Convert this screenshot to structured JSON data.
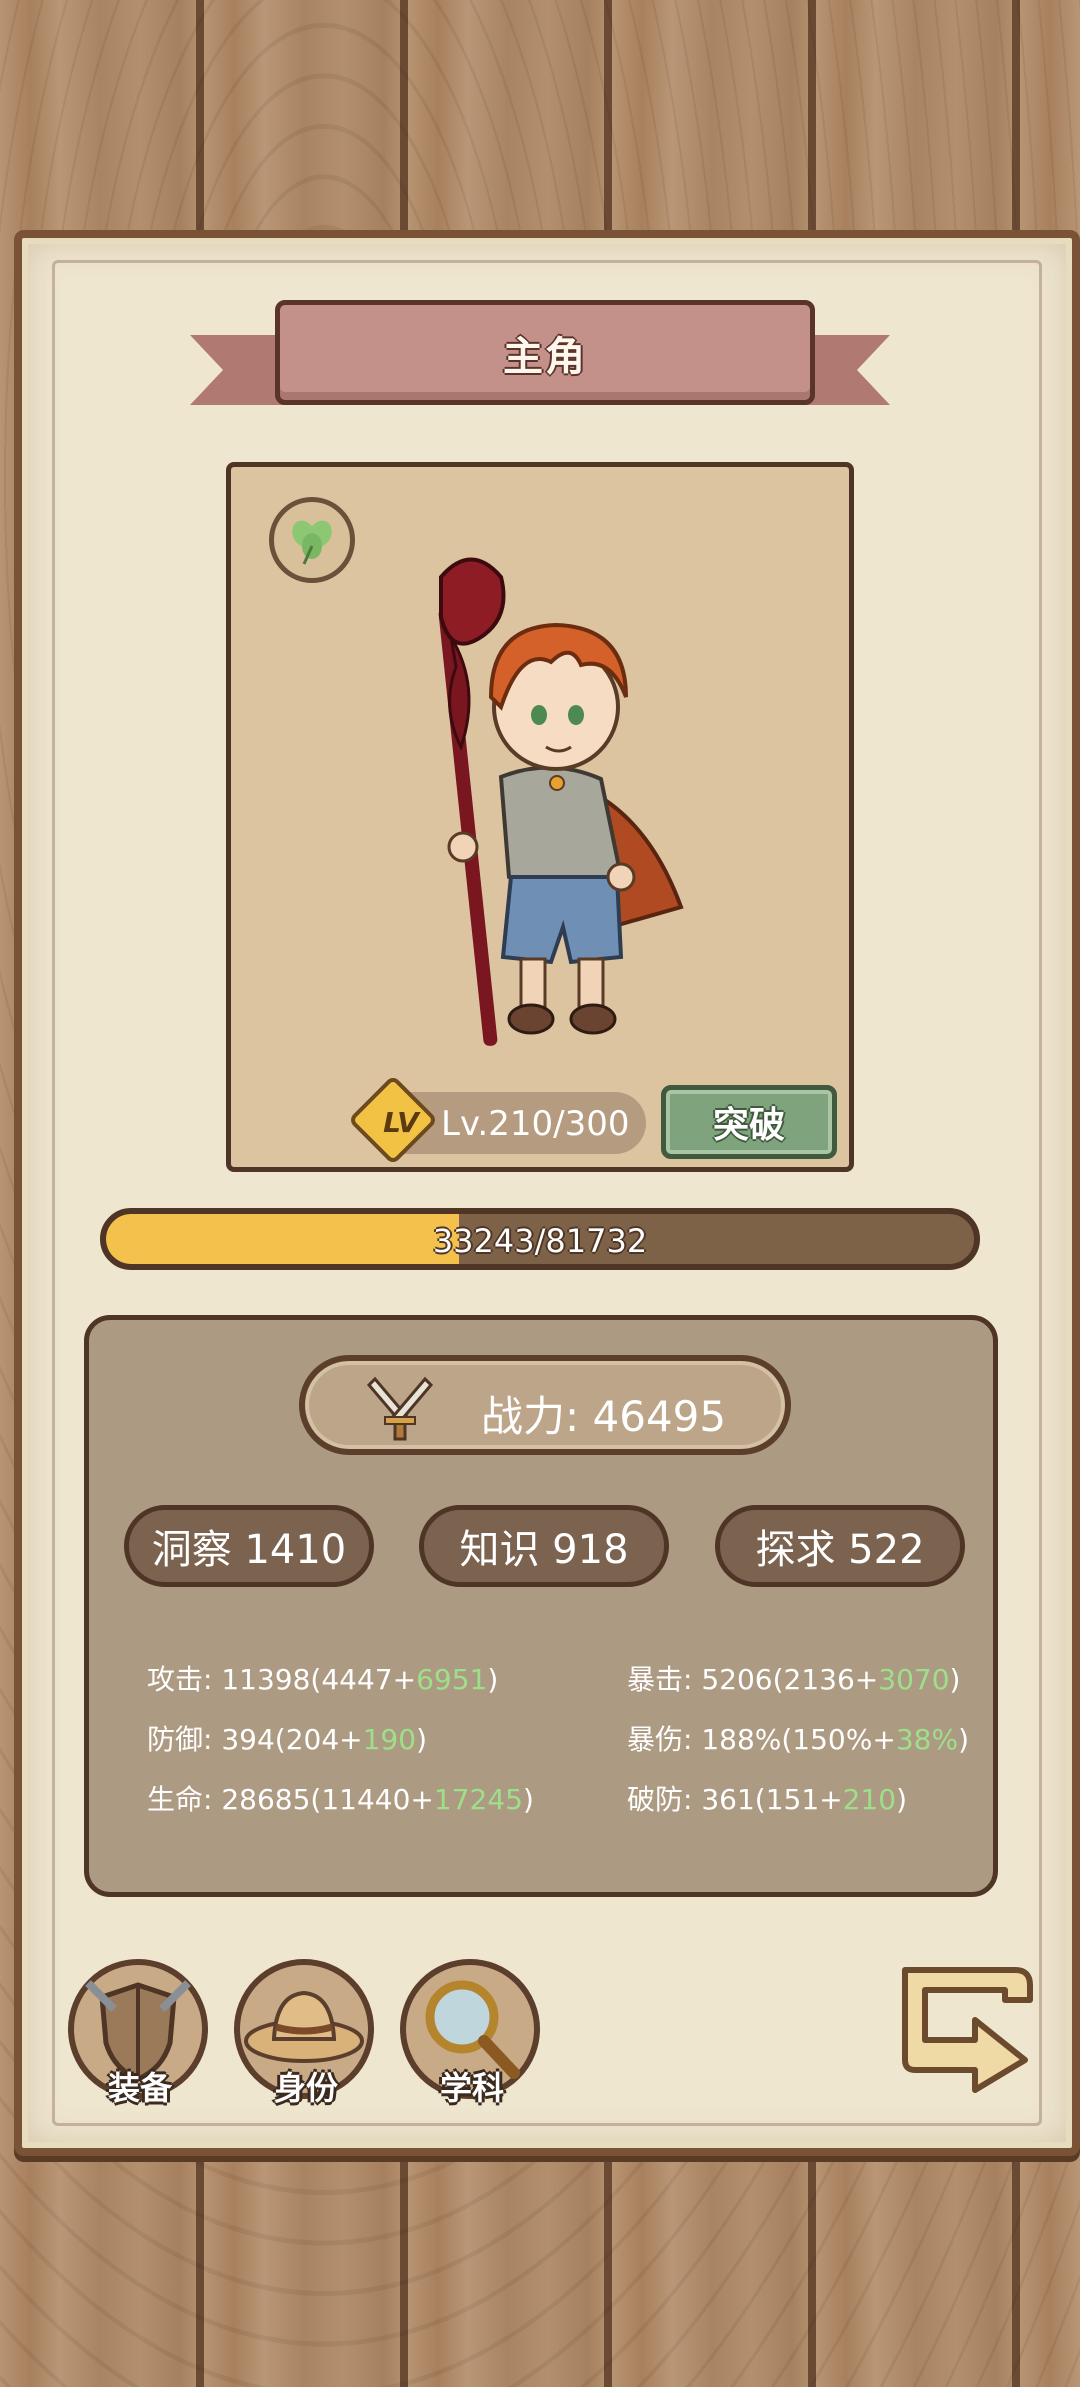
{
  "header": {
    "title": "主角"
  },
  "portrait": {
    "level_badge": "LV",
    "level_text": "Lv.210/300",
    "breakthrough_label": "突破"
  },
  "experience": {
    "text": "33243/81732",
    "current": 33243,
    "max": 81732
  },
  "stats": {
    "power_label": "战力: 46495",
    "attributes": [
      {
        "label": "洞察 1410"
      },
      {
        "label": "知识 918"
      },
      {
        "label": "探求 522"
      }
    ],
    "left": [
      {
        "prefix": "攻击: 11398(4447+",
        "bonus": "6951",
        "suffix": ")"
      },
      {
        "prefix": "防御: 394(204+",
        "bonus": "190",
        "suffix": ")"
      },
      {
        "prefix": "生命: 28685(11440+",
        "bonus": "17245",
        "suffix": ")"
      }
    ],
    "right": [
      {
        "prefix": "暴击: 5206(2136+",
        "bonus": "3070",
        "suffix": ")"
      },
      {
        "prefix": "暴伤: 188%(150%+",
        "bonus": "38%",
        "suffix": ")"
      },
      {
        "prefix": "破防: 361(151+",
        "bonus": "210",
        "suffix": ")"
      }
    ]
  },
  "bottom_nav": {
    "equipment": "装备",
    "identity": "身份",
    "subject": "学科"
  },
  "colors": {
    "xp_fill": "#f4c24c",
    "bonus_green": "#9ee08a",
    "break_button": "#7fa37c"
  }
}
